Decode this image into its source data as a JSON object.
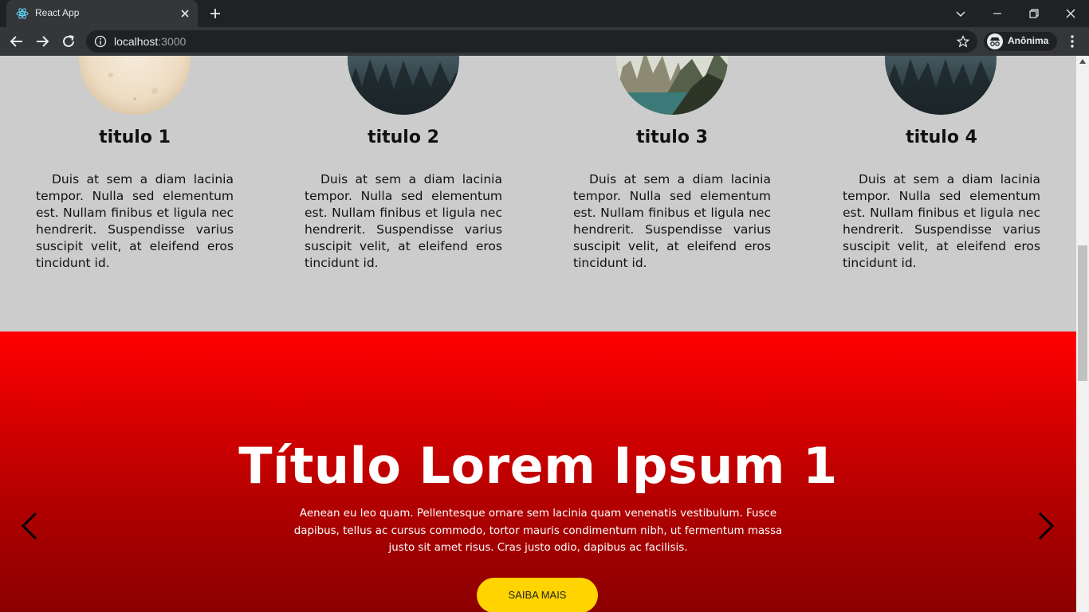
{
  "browser": {
    "tab_title": "React App",
    "url_host": "localhost",
    "url_port": ":3000",
    "profile_label": "Anônima"
  },
  "cards": [
    {
      "title": "titulo 1",
      "image": "parchment-texture-image",
      "text": "Duis at sem a diam lacinia tempor. Nulla sed elementum est. Nullam finibus et ligula nec hendrerit. Suspendisse varius suscipit velit, at eleifend eros tincidunt id."
    },
    {
      "title": "titulo 2",
      "image": "misty-forest-image",
      "text": "Duis at sem a diam lacinia tempor. Nulla sed elementum est. Nullam finibus et ligula nec hendrerit. Suspendisse varius suscipit velit, at eleifend eros tincidunt id."
    },
    {
      "title": "titulo 3",
      "image": "karst-mountains-image",
      "text": "Duis at sem a diam lacinia tempor. Nulla sed elementum est. Nullam finibus et ligula nec hendrerit. Suspendisse varius suscipit velit, at eleifend eros tincidunt id."
    },
    {
      "title": "titulo 4",
      "image": "misty-forest-image",
      "text": "Duis at sem a diam lacinia tempor. Nulla sed elementum est. Nullam finibus et ligula nec hendrerit. Suspendisse varius suscipit velit, at eleifend eros tincidunt id."
    }
  ],
  "hero": {
    "title": "Título Lorem Ipsum 1",
    "text": "Aenean eu leo quam. Pellentesque ornare sem lacinia quam venenatis vestibulum. Fusce dapibus, tellus ac cursus commodo, tortor mauris condimentum nibh, ut fermentum massa justo sit amet risus. Cras justo odio, dapibus ac facilisis.",
    "button_label": "SAIBA MAIS",
    "prev_icon": "chevron-left-icon",
    "next_icon": "chevron-right-icon"
  },
  "colors": {
    "hero_top": "#ff0000",
    "hero_bottom": "#8c0000",
    "button": "#ffd400",
    "page_background": "#cccccc"
  }
}
